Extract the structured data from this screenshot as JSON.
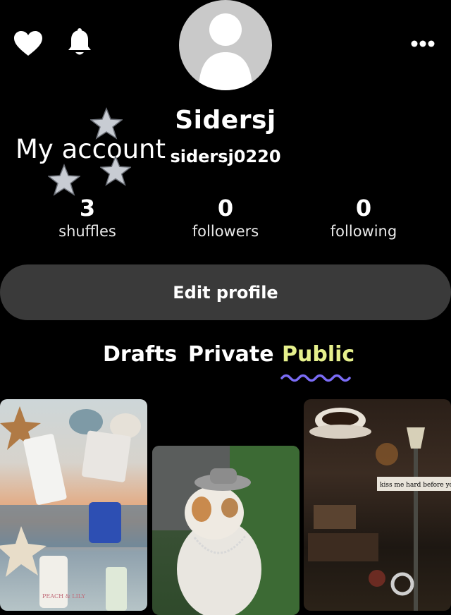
{
  "header": {
    "heart_icon": "heart-icon",
    "bell_icon": "bell-icon",
    "more_icon": "more-icon"
  },
  "profile": {
    "display_name": "Sidersj",
    "username": "sidersj0220",
    "sticker_text": "My account"
  },
  "stats": [
    {
      "value": "3",
      "label": "shuffles"
    },
    {
      "value": "0",
      "label": "followers"
    },
    {
      "value": "0",
      "label": "following"
    }
  ],
  "actions": {
    "edit_profile_label": "Edit profile"
  },
  "tabs": [
    {
      "label": "Drafts"
    },
    {
      "label": "Private"
    },
    {
      "label": "Public",
      "active": true
    }
  ],
  "thumbnails": [
    {
      "text": "PEACH & LILY"
    },
    {
      "text": ""
    },
    {
      "text": "kiss me hard before you go"
    }
  ],
  "colors": {
    "background": "#000000",
    "active_tab": "#e6f08c",
    "tab_underline": "#7b6cf6",
    "button_bg": "#3a3a3a"
  }
}
